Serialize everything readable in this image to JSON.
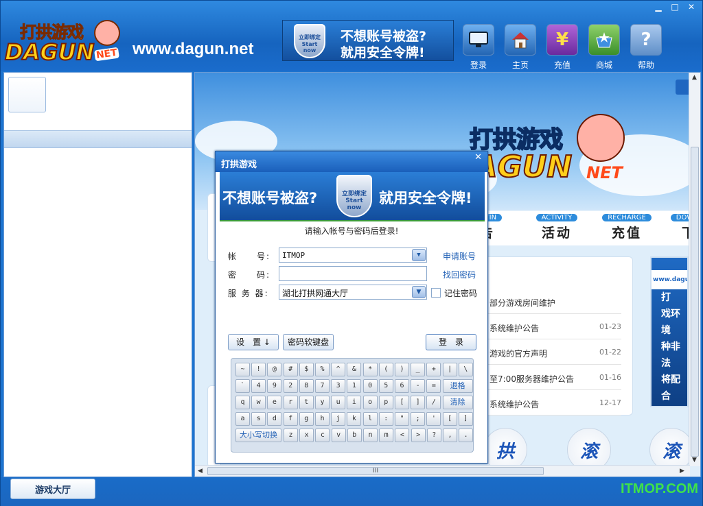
{
  "window": {
    "minimize": "▁",
    "maximize": "□",
    "close": "✕"
  },
  "header": {
    "logo_cn": "打拱游戏",
    "logo_en": "DAGUN",
    "logo_net": "NET",
    "site_url": "www.dagun.net",
    "ad": {
      "shield": "立即绑定 Start now",
      "line1": "不想账号被盗?",
      "line2": "就用安全令牌!"
    },
    "toolbar": [
      {
        "label": "登录",
        "icon": "monitor-icon"
      },
      {
        "label": "主页",
        "icon": "house-icon"
      },
      {
        "label": "充值",
        "icon": "yen-icon",
        "glyph": "¥"
      },
      {
        "label": "商城",
        "icon": "shop-icon"
      },
      {
        "label": "帮助",
        "icon": "help-icon",
        "glyph": "?"
      }
    ]
  },
  "content": {
    "banner_logo_cn": "打拱游戏",
    "banner_logo_en": "DAGUN",
    "banner_logo_net": "NET",
    "nav": [
      {
        "en": "BULLETIN",
        "cn": "公告"
      },
      {
        "en": "ACTIVITY",
        "cn": "活动"
      },
      {
        "en": "RECHARGE",
        "cn": "充值"
      },
      {
        "en": "DOWNLOAD",
        "cn": "下载"
      }
    ],
    "news": [
      {
        "title": "部分游戏房间维护",
        "date": ""
      },
      {
        "title": "系统维护公告",
        "date": "01-23"
      },
      {
        "title": "游戏的官方声明",
        "date": "01-22"
      },
      {
        "title": "至7:00服务器维护公告",
        "date": "01-16"
      },
      {
        "title": "系统维护公告",
        "date": "12-17"
      }
    ],
    "side_ad": {
      "url": "www.dagun",
      "lines": [
        "打",
        "戏环境",
        "种非法",
        "将配合"
      ]
    },
    "round_icons": [
      "拱",
      "滚",
      "滚"
    ],
    "hscroll_grip": "III"
  },
  "bottom": {
    "hall_button": "游戏大厅",
    "watermark": "ITMOP.COM"
  },
  "dialog": {
    "title": "打拱游戏",
    "close": "✕",
    "banner": {
      "left": "不想账号被盗?",
      "shield": "立即绑定 Start now",
      "right": "就用安全令牌!"
    },
    "prompt": "请输入帐号与密码后登录!",
    "account_label": "帐　　号:",
    "account_value": "ITMOP",
    "password_label": "密　　码:",
    "password_value": "",
    "server_label": "服 务 器:",
    "server_value": "湖北打拱网通大厅",
    "register_link": "申请账号",
    "recover_link": "找回密码",
    "remember_label": "记住密码",
    "settings_button": "设　置 ↓",
    "softkbd_button": "密码软键盘",
    "login_button": "登　录",
    "keyboard": {
      "row1": [
        "~",
        "!",
        "@",
        "#",
        "$",
        "%",
        "^",
        "&",
        "*",
        "(",
        ")",
        "_",
        "+",
        "|",
        "\\"
      ],
      "row2": [
        "`",
        "4",
        "9",
        "2",
        "8",
        "7",
        "3",
        "1",
        "0",
        "5",
        "6",
        "-",
        "="
      ],
      "backspace": "退格",
      "row3": [
        "q",
        "w",
        "e",
        "r",
        "t",
        "y",
        "u",
        "i",
        "o",
        "p",
        "[",
        "]",
        "/"
      ],
      "clear": "清除",
      "row4": [
        "a",
        "s",
        "d",
        "f",
        "g",
        "h",
        "j",
        "k",
        "l",
        ":",
        "\"",
        ";",
        "'",
        "[",
        "]"
      ],
      "caps": "大小写切换",
      "row5": [
        "z",
        "x",
        "c",
        "v",
        "b",
        "n",
        "m",
        "<",
        ">",
        "?",
        ",",
        "."
      ]
    }
  }
}
